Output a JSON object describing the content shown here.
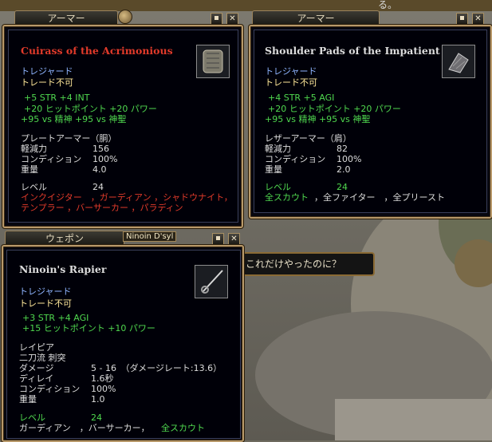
{
  "window1": {
    "tab": "アーマー",
    "name": "Cuirass of the Acrimonious",
    "treasure": "トレジャード",
    "trade": "トレード不可",
    "stats": [
      "+5 STR  +4 INT",
      "+20 ヒットポイント  +20 パワー",
      "+95 vs 精神  +95 vs 神聖"
    ],
    "type": "プレートアーマー（胴）",
    "attrs": [
      {
        "label": "軽減力",
        "value": "156"
      },
      {
        "label": "コンディション",
        "value": "100%"
      },
      {
        "label": "重量",
        "value": "4.0"
      }
    ],
    "level_label": "レベル",
    "level_value": "24",
    "classes_line1": "インクイジター　，ガーディアン ，シャドウナイト，",
    "classes_line2": "テンプラー ，バーサーカー ，パラディン"
  },
  "window2": {
    "tab": "アーマー",
    "name": "Shoulder Pads of the Impatient",
    "treasure": "トレジャード",
    "trade": "トレード不可",
    "stats": [
      "+4 STR  +5 AGI",
      "+20 ヒットポイント  +20 パワー",
      "+95 vs 精神  +95 vs 神聖"
    ],
    "type": "レザーアーマー（肩）",
    "attrs": [
      {
        "label": "軽減力",
        "value": "82"
      },
      {
        "label": "コンディション",
        "value": "100%"
      },
      {
        "label": "重量",
        "value": "2.0"
      }
    ],
    "level_label": "レベル",
    "level_value": "24",
    "classes_green": "全スカウト",
    "classes_rest": "，全ファイター　，全プリースト"
  },
  "window3": {
    "tab": "ウェポン",
    "owner": "Ninoin D'syl",
    "name": "Ninoin's Rapier",
    "treasure": "トレジャード",
    "trade": "トレード不可",
    "stats": [
      "+3 STR  +4 AGI",
      "+15 ヒットポイント  +10 パワー"
    ],
    "type": "レイピア",
    "style": "二刀流 刺突",
    "attrs": [
      {
        "label": "ダメージ",
        "value": "5 - 16　（ダメージレート:13.6）"
      },
      {
        "label": "ディレイ",
        "value": "1.6秒"
      },
      {
        "label": "コンディション",
        "value": "100%"
      },
      {
        "label": "重量",
        "value": "1.0"
      }
    ],
    "level_label": "レベル",
    "level_value": "24",
    "classes_white": "ガーディアン　，バーサーカー，",
    "classes_green": "全スカウト"
  },
  "chat_bubble": "これだけやったのに？",
  "top_fragment": "る。",
  "icons": {
    "minimize": "minimize-icon",
    "close": "close-icon"
  }
}
